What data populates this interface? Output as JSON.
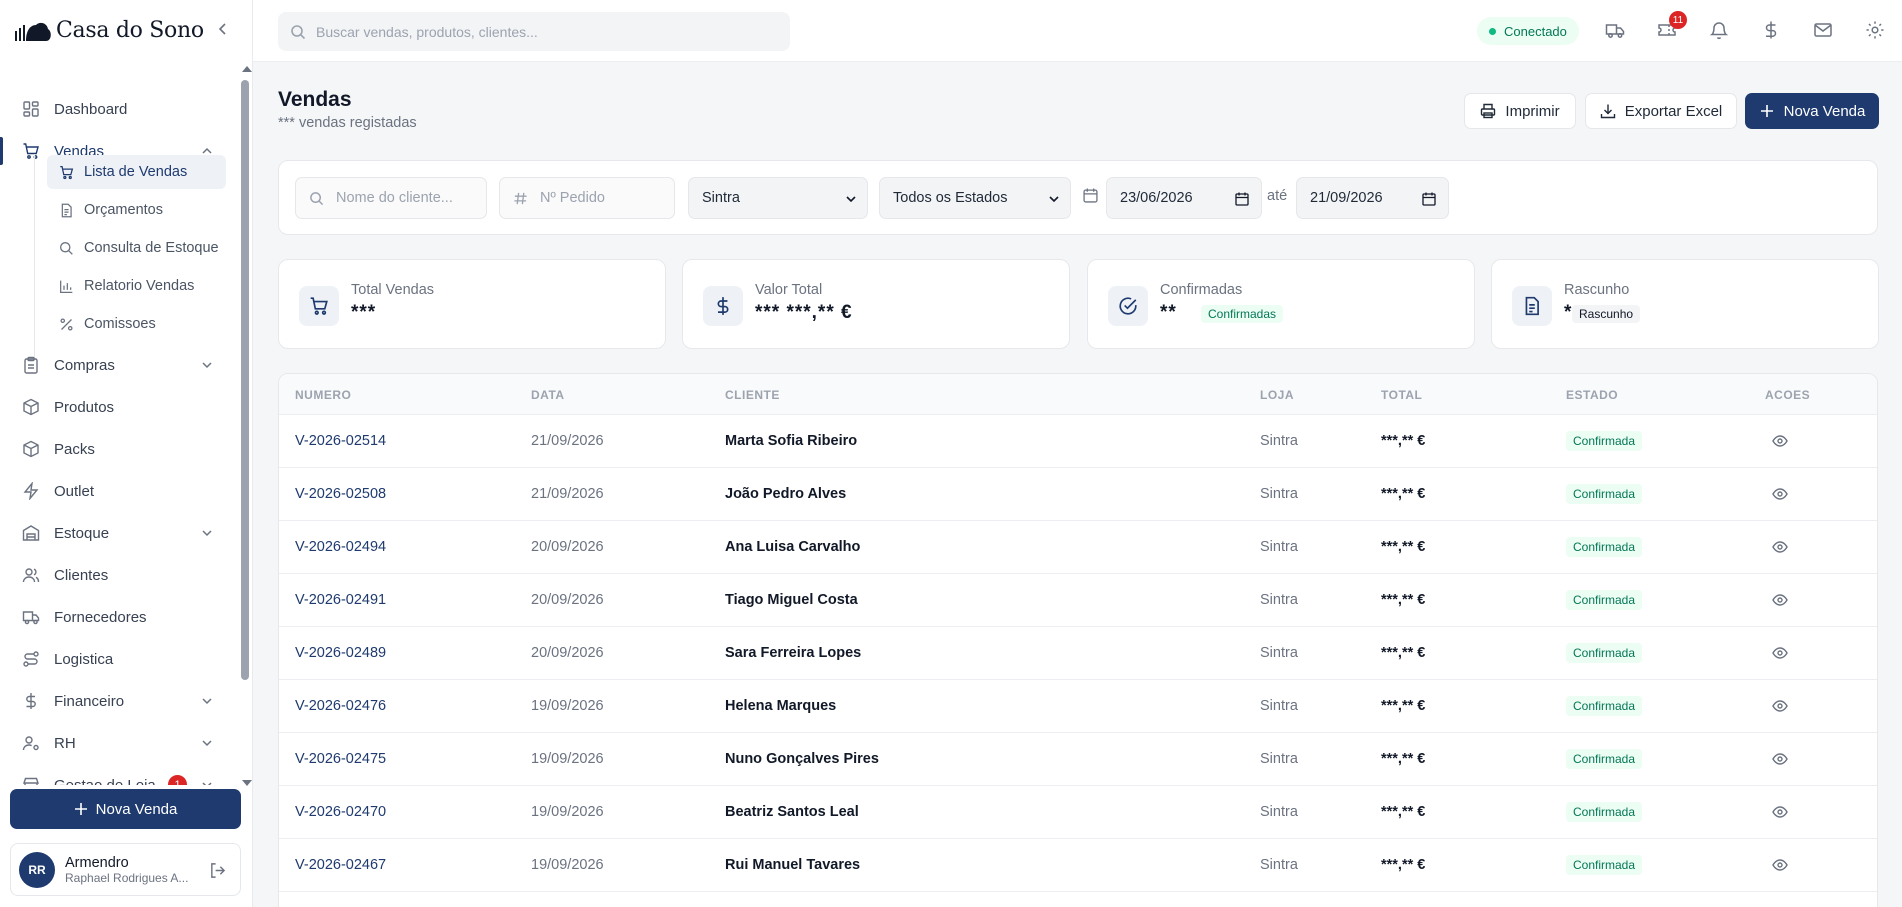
{
  "brand": {
    "name": "Casa do Sono"
  },
  "sidebar": {
    "items": [
      {
        "label": "Dashboard",
        "icon": "dashboard-icon"
      },
      {
        "label": "Vendas",
        "icon": "cart-icon",
        "expanded": true,
        "children": [
          {
            "label": "Lista de Vendas",
            "icon": "cart-icon",
            "active": true
          },
          {
            "label": "Orçamentos",
            "icon": "document-icon"
          },
          {
            "label": "Consulta de Estoque",
            "icon": "search-icon"
          },
          {
            "label": "Relatorio Vendas",
            "icon": "bar-chart-icon"
          },
          {
            "label": "Comissoes",
            "icon": "percent-icon"
          }
        ]
      },
      {
        "label": "Compras",
        "icon": "clipboard-icon",
        "has_children": true
      },
      {
        "label": "Produtos",
        "icon": "package-icon"
      },
      {
        "label": "Packs",
        "icon": "package-icon"
      },
      {
        "label": "Outlet",
        "icon": "zap-icon"
      },
      {
        "label": "Estoque",
        "icon": "warehouse-icon",
        "has_children": true
      },
      {
        "label": "Clientes",
        "icon": "users-icon"
      },
      {
        "label": "Fornecedores",
        "icon": "truck-icon"
      },
      {
        "label": "Logistica",
        "icon": "route-icon"
      },
      {
        "label": "Financeiro",
        "icon": "dollar-icon",
        "has_children": true
      },
      {
        "label": "RH",
        "icon": "user-cog-icon",
        "has_children": true
      },
      {
        "label": "Gestao de Loja",
        "icon": "store-icon",
        "has_children": true,
        "badge": "1"
      }
    ],
    "new_sale_label": "Nova Venda",
    "user": {
      "initials": "RR",
      "name": "Armendro",
      "subtitle": "Raphael Rodrigues A..."
    }
  },
  "topbar": {
    "search_placeholder": "Buscar vendas, produtos, clientes...",
    "status": "Conectado",
    "notifications_badge": "11"
  },
  "page": {
    "title": "Vendas",
    "subtitle": "*** vendas registadas",
    "print_label": "Imprimir",
    "export_label": "Exportar Excel",
    "new_sale_label": "Nova Venda"
  },
  "filters": {
    "client_placeholder": "Nome do cliente...",
    "order_placeholder": "Nº Pedido",
    "store": "Sintra",
    "state": "Todos os Estados",
    "date_from": "23/06/2026",
    "date_sep": "até",
    "date_to": "21/09/2026"
  },
  "stats": [
    {
      "label": "Total Vendas",
      "value": "***",
      "icon": "cart-icon"
    },
    {
      "label": "Valor Total",
      "value": "*** ***,** €",
      "icon": "dollar-icon"
    },
    {
      "label": "Confirmadas",
      "value": "**",
      "tag": "Confirmadas",
      "icon": "check-circle-icon"
    },
    {
      "label": "Rascunho",
      "value": "*",
      "tag": "Rascunho",
      "icon": "document-icon"
    }
  ],
  "table": {
    "columns": [
      "NUMERO",
      "DATA",
      "CLIENTE",
      "LOJA",
      "TOTAL",
      "ESTADO",
      "ACOES"
    ],
    "rows": [
      {
        "numero": "V-2026-02514",
        "data": "21/09/2026",
        "cliente": "Marta Sofia Ribeiro",
        "loja": "Sintra",
        "total": "***,** €",
        "estado": "Confirmada"
      },
      {
        "numero": "V-2026-02508",
        "data": "21/09/2026",
        "cliente": "João Pedro Alves",
        "loja": "Sintra",
        "total": "***,** €",
        "estado": "Confirmada"
      },
      {
        "numero": "V-2026-02494",
        "data": "20/09/2026",
        "cliente": "Ana Luisa Carvalho",
        "loja": "Sintra",
        "total": "***,** €",
        "estado": "Confirmada"
      },
      {
        "numero": "V-2026-02491",
        "data": "20/09/2026",
        "cliente": "Tiago Miguel Costa",
        "loja": "Sintra",
        "total": "***,** €",
        "estado": "Confirmada"
      },
      {
        "numero": "V-2026-02489",
        "data": "20/09/2026",
        "cliente": "Sara Ferreira Lopes",
        "loja": "Sintra",
        "total": "***,** €",
        "estado": "Confirmada"
      },
      {
        "numero": "V-2026-02476",
        "data": "19/09/2026",
        "cliente": "Helena Marques",
        "loja": "Sintra",
        "total": "***,** €",
        "estado": "Confirmada"
      },
      {
        "numero": "V-2026-02475",
        "data": "19/09/2026",
        "cliente": "Nuno Gonçalves Pires",
        "loja": "Sintra",
        "total": "***,** €",
        "estado": "Confirmada"
      },
      {
        "numero": "V-2026-02470",
        "data": "19/09/2026",
        "cliente": "Beatriz Santos Leal",
        "loja": "Sintra",
        "total": "***,** €",
        "estado": "Confirmada"
      },
      {
        "numero": "V-2026-02467",
        "data": "19/09/2026",
        "cliente": "Rui Manuel Tavares",
        "loja": "Sintra",
        "total": "***,** €",
        "estado": "Confirmada"
      }
    ]
  },
  "colors": {
    "primary": "#1e3a6e",
    "success": "#047857",
    "success_bg": "#ecfdf3",
    "badge": "#dc2626"
  }
}
